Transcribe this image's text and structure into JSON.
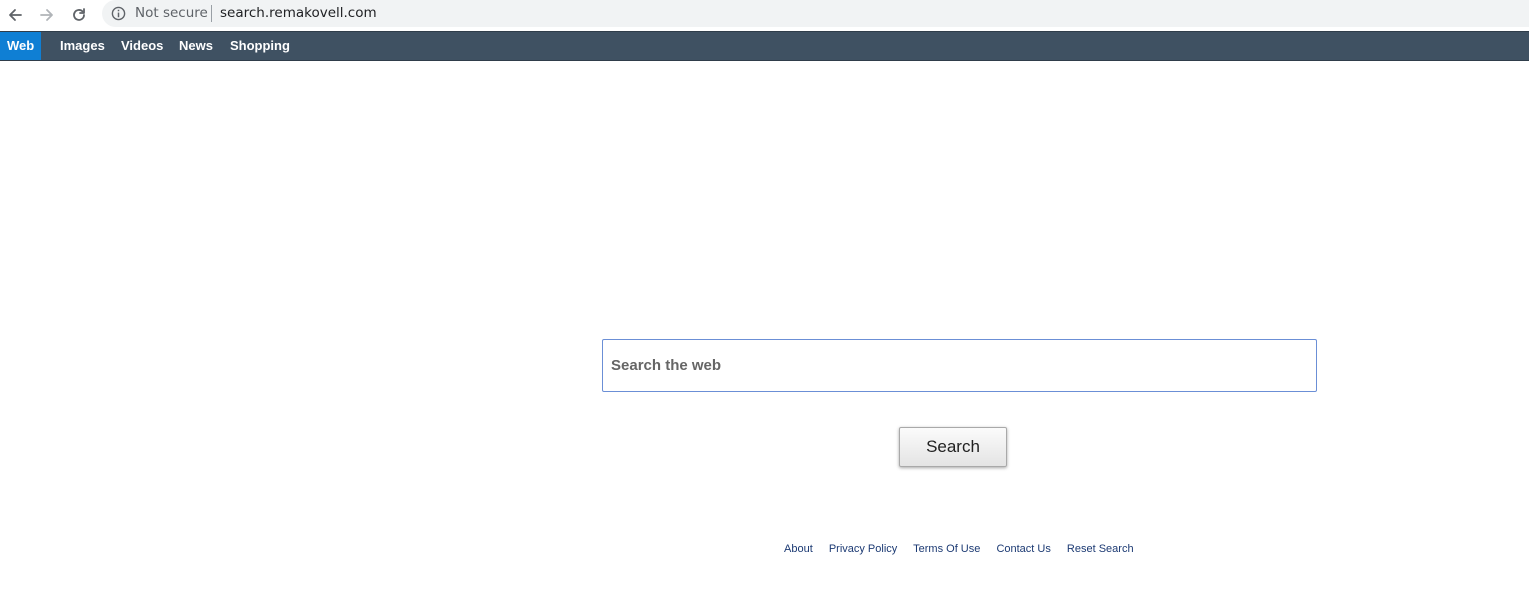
{
  "browser": {
    "security_label": "Not secure",
    "url": "search.remakovell.com"
  },
  "nav": {
    "tabs": [
      {
        "label": "Web",
        "active": true
      },
      {
        "label": "Images",
        "active": false
      },
      {
        "label": "Videos",
        "active": false
      },
      {
        "label": "News",
        "active": false
      },
      {
        "label": "Shopping",
        "active": false
      }
    ]
  },
  "search": {
    "placeholder": "Search the web",
    "value": "",
    "button_label": "Search"
  },
  "footer": {
    "links": [
      "About",
      "Privacy Policy",
      "Terms Of Use",
      "Contact Us",
      "Reset Search"
    ]
  },
  "colors": {
    "nav_bg": "#3f5162",
    "active_tab": "#0f7fd4",
    "footer_link": "#1c3a73",
    "input_border": "#6b8fd6"
  }
}
